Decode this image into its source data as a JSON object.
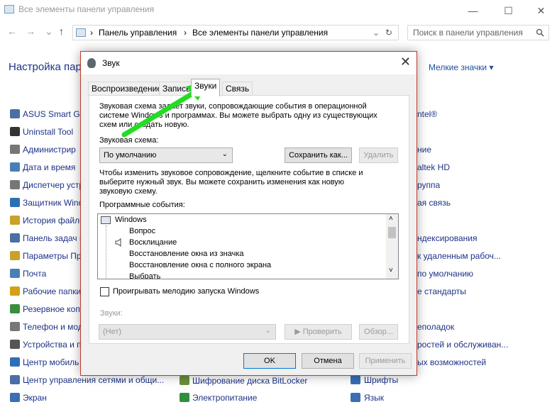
{
  "window": {
    "title": "Все элементы панели управления",
    "minimize": "—",
    "maximize": "☐",
    "close": "✕"
  },
  "address": {
    "back": "←",
    "forward": "→",
    "dropdown": "⌄",
    "up": "↑",
    "segment1": "Панель управления",
    "sep1": "›",
    "segment2": "Все элементы панели управления",
    "sep2": "›",
    "refresh": "↻",
    "search_placeholder": "Поиск в панели управления"
  },
  "cp": {
    "heading": "Настройка пар",
    "view_by": "Мелкие значки",
    "view_by_arrow": "▾",
    "left_items": [
      "ASUS Smart Ges",
      "Uninstall Tool",
      "Администрир",
      "Дата и время",
      "Диспетчер устр",
      "Защитник Wind",
      "История файло",
      "Панель задач и",
      "Параметры Пр",
      "Почта",
      "Рабочие папки",
      "Резервное копи",
      "Телефон и мод",
      "Устройства и п",
      "Центр мобиль",
      "Центр управления сетями и общи...",
      "Экран"
    ],
    "mid_items": [
      "Шифрование диска BitLocker",
      "Электропитание"
    ],
    "right_items": [
      "ntel®",
      "",
      "ние",
      "altek HD",
      "руппа",
      "ая связь",
      "",
      "ндексирования",
      "к удаленным рабоч...",
      "по умолчанию",
      "е стандарты",
      "",
      "еполадок",
      "ростей и обслуживан...",
      "ых возможностей",
      "Шрифты",
      "Язык"
    ]
  },
  "dialog": {
    "title": "Звук",
    "close": "✕",
    "tabs": [
      "Воспроизведение",
      "Запись",
      "Звуки",
      "Связь"
    ],
    "description": [
      "Звуковая схема задает звуки, сопровождающие события в операционной",
      "системе Windows и программах. Вы можете выбрать одну из существующих",
      "схем или создать новую."
    ],
    "scheme_label": "Звуковая схема:",
    "scheme_value": "По умолчанию",
    "save_as": "Сохранить как...",
    "delete": "Удалить",
    "instructions": [
      "Чтобы изменить звуковое сопровождение, щелкните событие в списке и",
      "выберите нужный звук. Вы можете сохранить изменения как новую",
      "звуковую схему."
    ],
    "events_label": "Программные события:",
    "events": [
      "Windows",
      "Вопрос",
      "Восклицание",
      "Восстановление окна из значка",
      "Восстановление окна с полного экрана",
      "Выбрать"
    ],
    "scroll_up": "˄",
    "scroll_down": "˅",
    "play_startup": "Проигрывать мелодию запуска Windows",
    "sounds_label": "Звуки:",
    "sound_value": "(Нет)",
    "test": "▶ Проверить",
    "browse": "Обзор...",
    "ok": "OK",
    "cancel": "Отмена",
    "apply": "Применить",
    "arrow_color": "#22dd22"
  }
}
